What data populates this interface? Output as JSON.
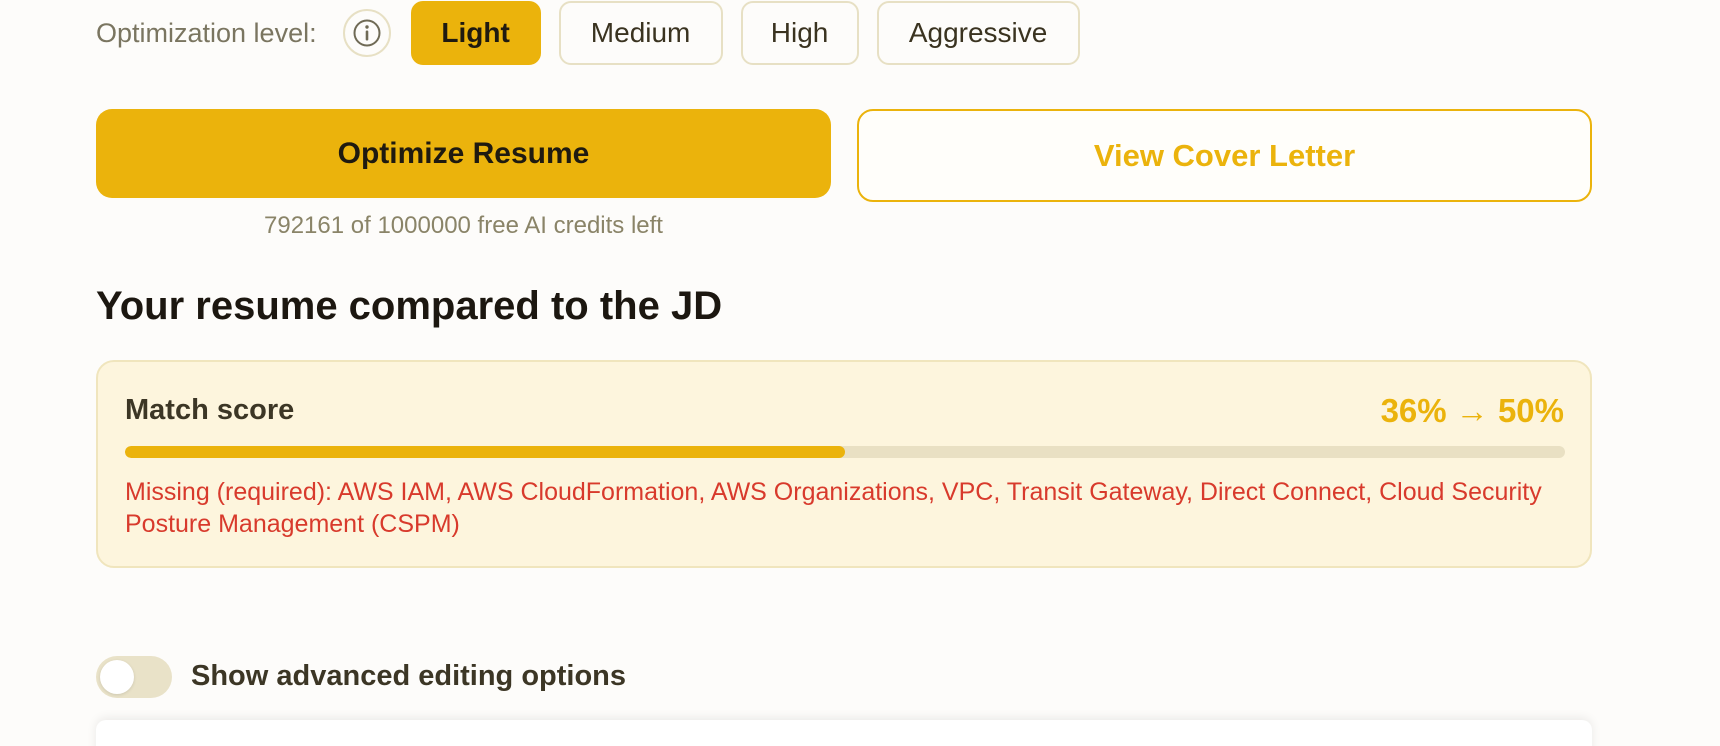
{
  "optimization": {
    "label": "Optimization level:",
    "info_icon": "info-circle-icon",
    "levels": [
      "Light",
      "Medium",
      "High",
      "Aggressive"
    ],
    "selected": "Light"
  },
  "actions": {
    "optimize_label": "Optimize Resume",
    "cover_letter_label": "View Cover Letter"
  },
  "credits_text": "792161 of 1000000 free AI credits left",
  "comparison": {
    "title": "Your resume compared to the JD",
    "match_label": "Match score",
    "match_value": "36% → 50%",
    "progress_fraction": 0.5,
    "missing_text": "Missing (required): AWS IAM, AWS CloudFormation, AWS Organizations, VPC, Transit Gateway, Direct Connect, Cloud Security Posture Management (CSPM)"
  },
  "advanced": {
    "toggle_label": "Show advanced editing options",
    "enabled": false
  },
  "colors": {
    "accent": "#ebb30c",
    "card_background": "#fdf5dd",
    "missing_text": "#d83a2c"
  }
}
